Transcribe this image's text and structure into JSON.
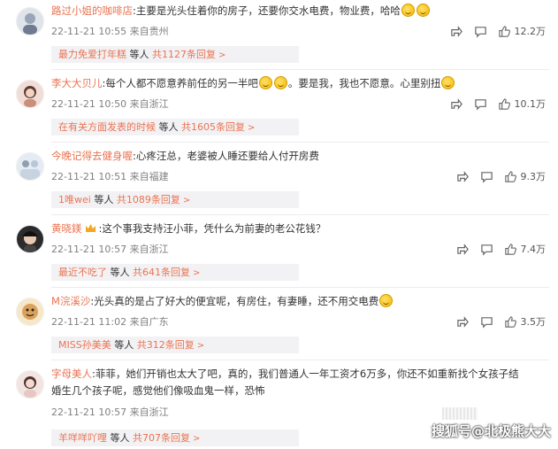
{
  "comments": [
    {
      "user": "路过小姐的咖啡店",
      "text": ":主要是光头住着你的房子，还要你交水电费，物业费，哈哈",
      "emoji_count": 2,
      "time": "22-11-21 10:55",
      "location": "来自贵州",
      "likes": "12.2万",
      "reply_user": "最力免爱打年糕",
      "reply_middle": " 等人 ",
      "reply_count": "共1127条回复",
      "avatar_color": "#9aa4b8"
    },
    {
      "user": "李大大贝儿",
      "text": ":每个人都不愿意养前任的另一半吧",
      "text2": "。要是我，我也不愿意。心里别扭",
      "time": "22-11-21 10:50",
      "location": "来自浙江",
      "likes": "10.1万",
      "reply_user": "在有关方面发表的时候",
      "reply_middle": " 等人 ",
      "reply_count": "共1605条回复",
      "avatar_color": "#c98e7c"
    },
    {
      "user": "今晚记得去健身喔",
      "text": ":心疼汪总，老婆被人睡还要给人付开房费",
      "time": "22-11-21 10:51",
      "location": "来自福建",
      "likes": "9.3万",
      "reply_user": "1唯wei",
      "reply_middle": " 等人 ",
      "reply_count": "共1089条回复",
      "avatar_color": "#b7c6d8"
    },
    {
      "user": "黄晓鎂",
      "text": ":这个事我支持汪小菲，凭什么为前妻的老公花钱？",
      "time": "22-11-21 10:57",
      "location": "来自浙江",
      "likes": "7.4万",
      "reply_user": "最近不吃了",
      "reply_middle": " 等人 ",
      "reply_count": "共641条回复",
      "avatar_color": "#3a3a3a"
    },
    {
      "user": "M浣溪沙",
      "text": ":光头真的是占了好大的便宜呢，有房住，有妻睡，还不用交电费",
      "time": "22-11-21 11:02",
      "location": "来自广东",
      "likes": "3.5万",
      "reply_user": "MISS孙美美",
      "reply_middle": " 等人 ",
      "reply_count": "共312条回复",
      "avatar_color": "#d9a25c"
    },
    {
      "user": "字母美人",
      "text": ":菲菲，她们开销也太大了吧，真的，我们普通人一年工资才6万多，你还不如重新找个女孩子结",
      "text2": "婚生几个孩子呢，感觉他们像吸血鬼一样，恐怖",
      "time": "22-11-21 10:57",
      "location": "来自浙江",
      "likes": "",
      "reply_user": "羊咩咩吖哩",
      "reply_middle": " 等人 ",
      "reply_count": "共707条回复",
      "avatar_color": "#e6c7c2"
    }
  ],
  "watermark": "搜狐号@北极熊大大",
  "icons": {
    "share": "share-icon",
    "comment": "comment-icon",
    "like": "thumbs-up-icon"
  }
}
